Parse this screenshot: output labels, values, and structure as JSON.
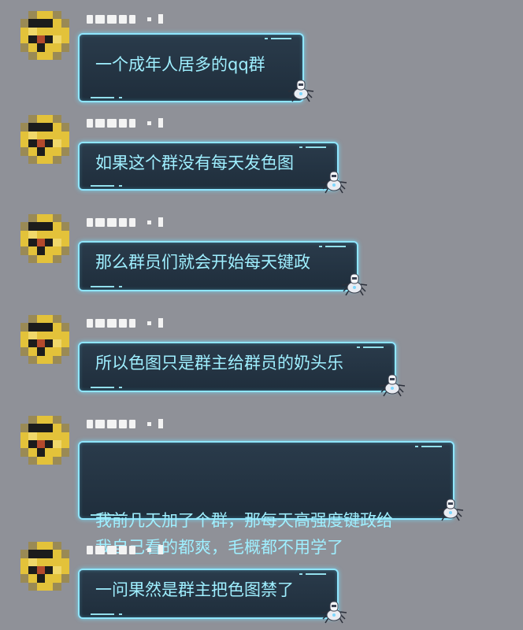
{
  "colors": {
    "background": "#8f9198",
    "bubble_fill": "#22313f",
    "bubble_border": "#8fe6ff",
    "bubble_text": "#9fefff",
    "avatar_yellow": "#e3c23a",
    "avatar_black": "#1c1c1c",
    "avatar_red": "#b44a2c"
  },
  "messages": [
    {
      "avatar_icon": "pixelated-avatar-icon",
      "text": "一个成年人居多的qq群",
      "mascot_icon": "robot-spider-icon"
    },
    {
      "avatar_icon": "pixelated-avatar-icon",
      "text": "如果这个群没有每天发色图",
      "mascot_icon": "robot-spider-icon"
    },
    {
      "avatar_icon": "pixelated-avatar-icon",
      "text": "那么群员们就会开始每天键政",
      "mascot_icon": "robot-spider-icon"
    },
    {
      "avatar_icon": "pixelated-avatar-icon",
      "text": "所以色图只是群主给群员的奶头乐",
      "mascot_icon": "robot-spider-icon"
    },
    {
      "avatar_icon": "pixelated-avatar-icon",
      "text": "我前几天加了个群，那每天高强度键政给\n我自己看的都爽，毛概都不用学了",
      "mascot_icon": "robot-spider-icon"
    },
    {
      "avatar_icon": "pixelated-avatar-icon",
      "text": "一问果然是群主把色图禁了",
      "mascot_icon": "robot-spider-icon"
    }
  ]
}
